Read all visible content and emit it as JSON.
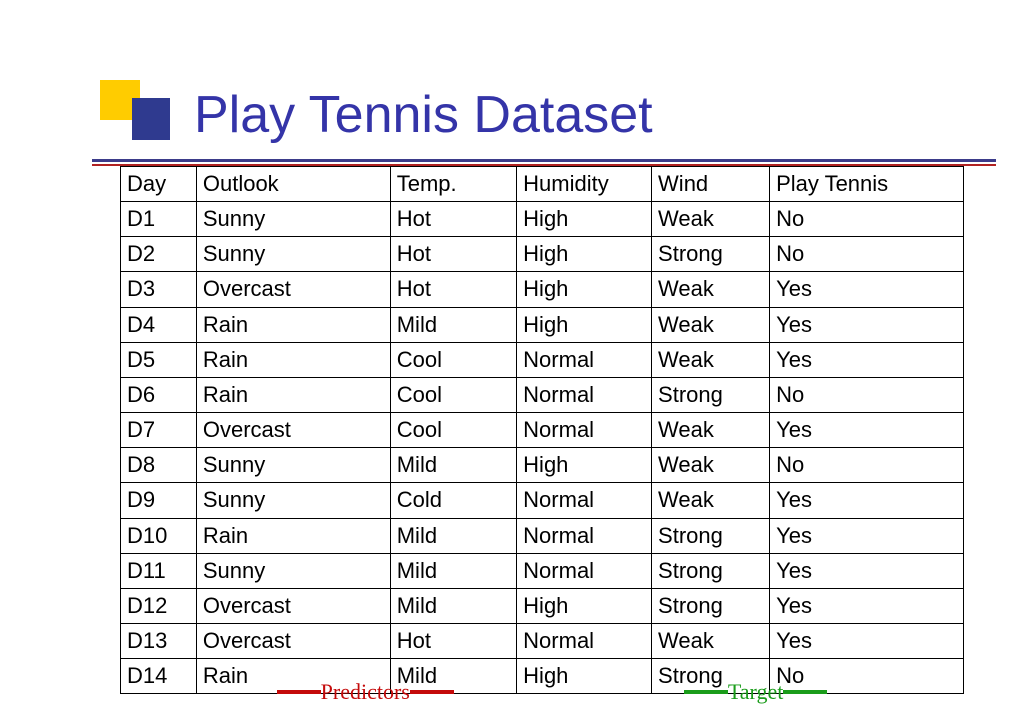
{
  "title": "Play Tennis Dataset",
  "headers": [
    "Day",
    "Outlook",
    "Temp.",
    "Humidity",
    "Wind",
    "Play Tennis"
  ],
  "rows": [
    [
      "D1",
      "Sunny",
      "Hot",
      "High",
      "Weak",
      "No"
    ],
    [
      "D2",
      "Sunny",
      "Hot",
      "High",
      "Strong",
      "No"
    ],
    [
      "D3",
      "Overcast",
      "Hot",
      "High",
      "Weak",
      "Yes"
    ],
    [
      "D4",
      "Rain",
      "Mild",
      "High",
      "Weak",
      "Yes"
    ],
    [
      "D5",
      "Rain",
      "Cool",
      "Normal",
      "Weak",
      "Yes"
    ],
    [
      "D6",
      "Rain",
      "Cool",
      "Normal",
      "Strong",
      "No"
    ],
    [
      "D7",
      "Overcast",
      "Cool",
      "Normal",
      "Weak",
      "Yes"
    ],
    [
      "D8",
      "Sunny",
      "Mild",
      "High",
      "Weak",
      "No"
    ],
    [
      "D9",
      "Sunny",
      "Cold",
      "Normal",
      "Weak",
      "Yes"
    ],
    [
      "D10",
      "Rain",
      "Mild",
      "Normal",
      "Strong",
      "Yes"
    ],
    [
      "D11",
      "Sunny",
      "Mild",
      "Normal",
      "Strong",
      "Yes"
    ],
    [
      "D12",
      "Overcast",
      "Mild",
      "High",
      "Strong",
      "Yes"
    ],
    [
      "D13",
      "Overcast",
      "Hot",
      "Normal",
      "Weak",
      "Yes"
    ],
    [
      "D14",
      "Rain",
      "Mild",
      "High",
      "Strong",
      "No"
    ]
  ],
  "legend": {
    "predictors": "Predictors",
    "target": "Target"
  }
}
